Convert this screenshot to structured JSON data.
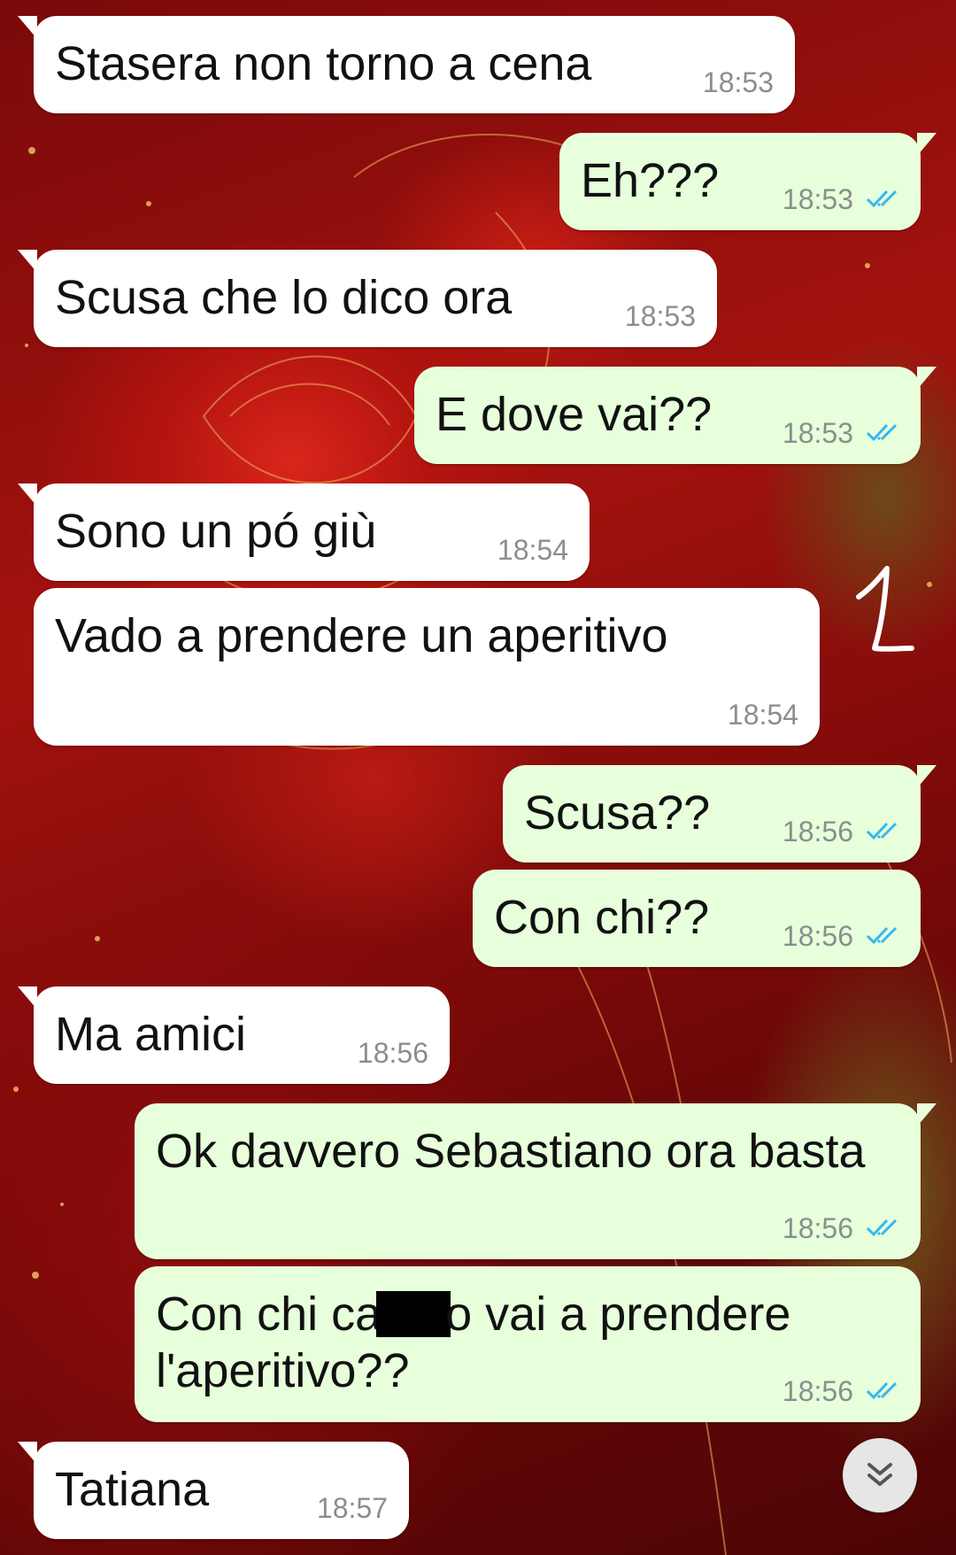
{
  "chat": {
    "messages": [
      {
        "direction": "incoming",
        "text": "Stasera non torno a cena",
        "time": "18:53"
      },
      {
        "direction": "outgoing",
        "text": "Eh???",
        "time": "18:53",
        "status": "read"
      },
      {
        "direction": "incoming",
        "text": "Scusa che lo dico ora",
        "time": "18:53"
      },
      {
        "direction": "outgoing",
        "text": "E dove vai??",
        "time": "18:53",
        "status": "read"
      },
      {
        "direction": "incoming",
        "text": "Sono un pó giù",
        "time": "18:54"
      },
      {
        "direction": "incoming",
        "text": "Vado a prendere un aperitivo",
        "time": "18:54"
      },
      {
        "direction": "outgoing",
        "text": "Scusa??",
        "time": "18:56",
        "status": "read"
      },
      {
        "direction": "outgoing",
        "text": "Con chi??",
        "time": "18:56",
        "status": "read"
      },
      {
        "direction": "incoming",
        "text": "Ma amici",
        "time": "18:56"
      },
      {
        "direction": "outgoing",
        "text": "Ok davvero Sebastiano ora basta",
        "time": "18:56",
        "status": "read"
      },
      {
        "direction": "outgoing",
        "text_before": "Con chi ca",
        "text_after": "o vai a prendere",
        "text_line2": "l'aperitivo??",
        "time": "18:56",
        "status": "read"
      },
      {
        "direction": "incoming",
        "text": "Tatiana",
        "time": "18:57"
      }
    ]
  },
  "annotation": {
    "mark": "1"
  },
  "icons": {
    "read_ticks": "double-check-icon",
    "scroll_down": "double-chevron-down-icon",
    "tick_color": "#34b7f1"
  },
  "colors": {
    "incoming_bubble": "#ffffff",
    "outgoing_bubble": "#e7ffdb",
    "timestamp": "#8a8f8c"
  }
}
